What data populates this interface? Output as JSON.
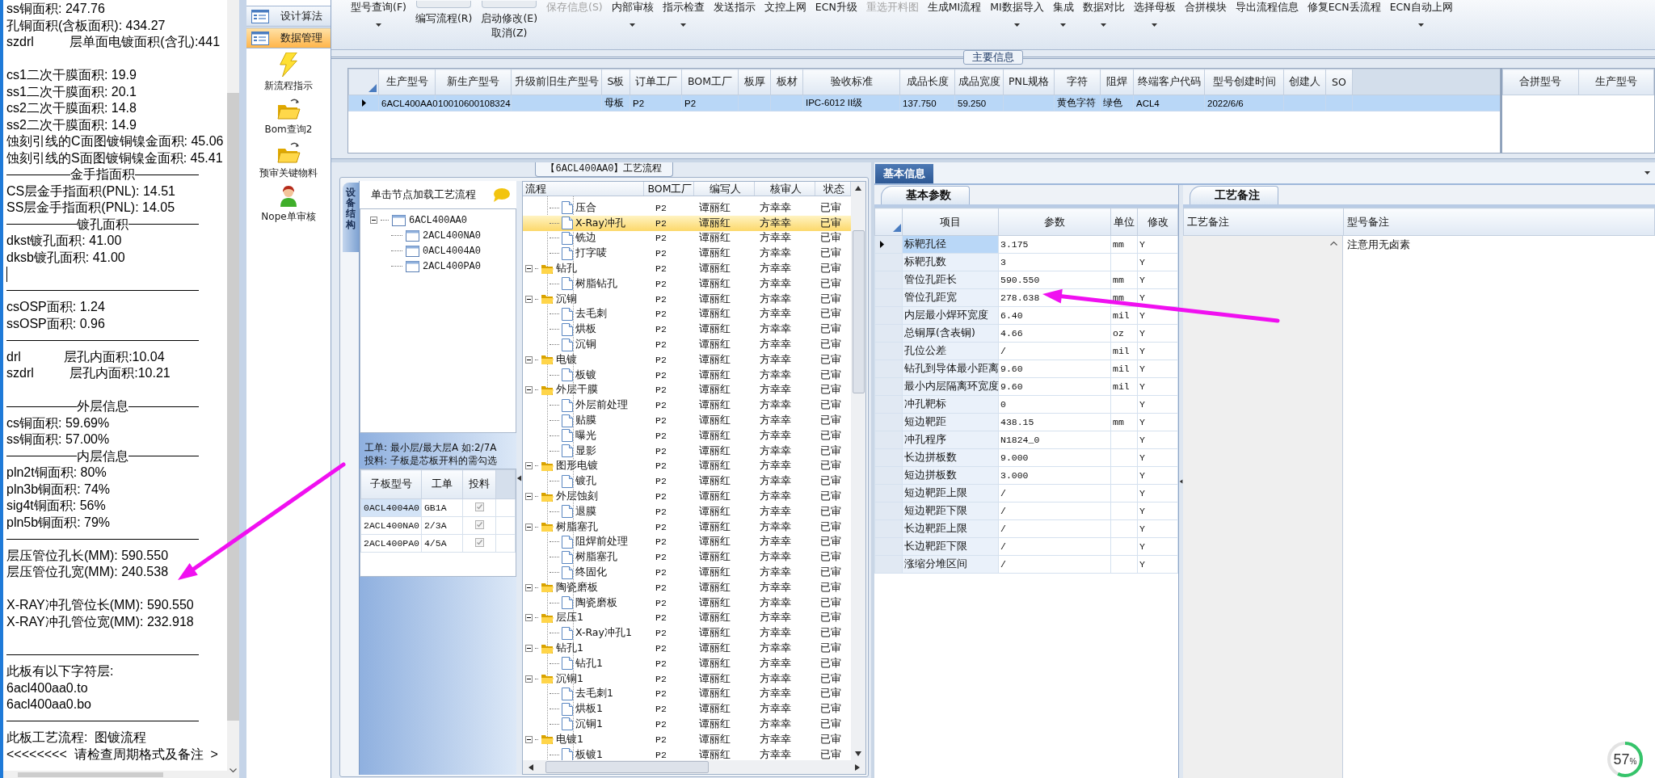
{
  "report_panel": {
    "lines": [
      {
        "kind": "text",
        "text": "ss铜面积: 247.76"
      },
      {
        "kind": "text",
        "text": "孔铜面积(含板面积): 434.27"
      },
      {
        "kind": "text",
        "text": "szdrl          层单面电镀面积(含孔):441"
      },
      {
        "kind": "blank"
      },
      {
        "kind": "text",
        "text": "cs1二次干膜面积: 19.9"
      },
      {
        "kind": "text",
        "text": "ss1二次干膜面积: 20.1"
      },
      {
        "kind": "text",
        "text": "cs2二次干膜面积: 14.8"
      },
      {
        "kind": "text",
        "text": "ss2二次干膜面积: 14.9"
      },
      {
        "kind": "text",
        "text": "蚀刻引线的C面图镀铜镍金面积: 45.06"
      },
      {
        "kind": "text",
        "text": "蚀刻引线的S面图镀铜镍金面积: 45.41"
      },
      {
        "kind": "heading",
        "text": "金手指面积"
      },
      {
        "kind": "text",
        "text": "CS层金手指面积(PNL): 14.51"
      },
      {
        "kind": "text",
        "text": "SS层金手指面积(PNL): 14.05"
      },
      {
        "kind": "heading",
        "text": "镀孔面积"
      },
      {
        "kind": "text",
        "text": "dkst镀孔面积: 41.00"
      },
      {
        "kind": "text",
        "text": "dksb镀孔面积: 41.00"
      },
      {
        "kind": "caret"
      },
      {
        "kind": "rule"
      },
      {
        "kind": "text",
        "text": "csOSP面积: 1.24"
      },
      {
        "kind": "text",
        "text": "ssOSP面积: 0.96"
      },
      {
        "kind": "rule"
      },
      {
        "kind": "text",
        "text": "drl            层孔内面积:10.04"
      },
      {
        "kind": "text",
        "text": "szdrl          层孔内面积:10.21"
      },
      {
        "kind": "blank"
      },
      {
        "kind": "heading",
        "text": "外层信息"
      },
      {
        "kind": "text",
        "text": "cs铜面积: 59.69%"
      },
      {
        "kind": "text",
        "text": "ss铜面积: 57.00%"
      },
      {
        "kind": "heading",
        "text": "内层信息"
      },
      {
        "kind": "text",
        "text": "pln2t铜面积: 80%"
      },
      {
        "kind": "text",
        "text": "pln3b铜面积: 74%"
      },
      {
        "kind": "text",
        "text": "sig4t铜面积: 56%"
      },
      {
        "kind": "text",
        "text": "pln5b铜面积: 79%"
      },
      {
        "kind": "rule"
      },
      {
        "kind": "text",
        "text": "层压管位孔长(MM): 590.550"
      },
      {
        "kind": "text",
        "text": "层压管位孔宽(MM): 240.538"
      },
      {
        "kind": "blank"
      },
      {
        "kind": "text",
        "text": "X-RAY冲孔管位长(MM): 590.550"
      },
      {
        "kind": "text",
        "text": "X-RAY冲孔管位宽(MM): 232.918"
      },
      {
        "kind": "blank"
      },
      {
        "kind": "rule"
      },
      {
        "kind": "text",
        "text": "此板有以下字符层:"
      },
      {
        "kind": "text",
        "text": "6acl400aa0.to"
      },
      {
        "kind": "text",
        "text": "6acl400aa0.bo"
      },
      {
        "kind": "rule"
      },
      {
        "kind": "text",
        "text": "此板工艺流程:  图镀流程"
      },
      {
        "kind": "text",
        "text": "<<<<<<<<  请检查周期格式及备注  >"
      }
    ]
  },
  "nav": {
    "items": [
      {
        "label": "设计算法",
        "selected": false
      },
      {
        "label": "数据管理",
        "selected": true
      }
    ],
    "launchers": [
      {
        "label": "新流程指示",
        "kind": "bolt"
      },
      {
        "label": "Bom查询2",
        "kind": "folder"
      },
      {
        "label": "预审关键物料",
        "kind": "folder"
      },
      {
        "label": "Nope单审核",
        "kind": "user"
      }
    ]
  },
  "toolbar": [
    {
      "label": "型号查询(F)",
      "kind": "text",
      "dropdown": true,
      "disabled": false
    },
    {
      "label": "编写流程(R)",
      "kind": "image",
      "dropdown": false,
      "disabled": false
    },
    {
      "label": "启动修改(E)",
      "kind": "image",
      "dropdown": false,
      "disabled": false,
      "sub_label": "取消(Z)"
    },
    {
      "label": "保存信息(S)",
      "kind": "text",
      "dropdown": false,
      "disabled": true
    },
    {
      "label": "内部审核",
      "kind": "text",
      "dropdown": true,
      "disabled": false
    },
    {
      "label": "指示检查",
      "kind": "text",
      "dropdown": true,
      "disabled": false
    },
    {
      "label": "发送指示",
      "kind": "text",
      "dropdown": false,
      "disabled": false
    },
    {
      "label": "文控上网",
      "kind": "text",
      "dropdown": false,
      "disabled": false
    },
    {
      "label": "ECN升级",
      "kind": "text",
      "dropdown": false,
      "disabled": false
    },
    {
      "label": "重选开料图",
      "kind": "text",
      "dropdown": false,
      "disabled": true
    },
    {
      "label": "生成MI流程",
      "kind": "text",
      "dropdown": false,
      "disabled": false
    },
    {
      "label": "MI数据导入",
      "kind": "text",
      "dropdown": true,
      "disabled": false
    },
    {
      "label": "集成",
      "kind": "text",
      "dropdown": true,
      "disabled": false
    },
    {
      "label": "数据对比",
      "kind": "text",
      "dropdown": true,
      "disabled": false
    },
    {
      "label": "选择母板",
      "kind": "text",
      "dropdown": true,
      "disabled": false
    },
    {
      "label": "合拼模块",
      "kind": "text",
      "dropdown": false,
      "disabled": false
    },
    {
      "label": "导出流程信息",
      "kind": "text",
      "dropdown": false,
      "disabled": false
    },
    {
      "label": "修复ECN丢流程",
      "kind": "text",
      "dropdown": false,
      "disabled": false
    },
    {
      "label": "ECN自动上网",
      "kind": "text",
      "dropdown": true,
      "disabled": false
    }
  ],
  "main_info": {
    "title": "主要信息",
    "columns": [
      "生产型号",
      "新生产型号",
      "升级前旧生产型号",
      "S板",
      "订单工厂",
      "BOM工厂",
      "板厚",
      "板材",
      "验收标准",
      "成品长度",
      "成品宽度",
      "PNL规格",
      "字符",
      "阻焊",
      "终端客户代码",
      "型号创建时间",
      "创建人",
      "SO"
    ],
    "rows": [
      {
        "selected": true,
        "cells": [
          "6ACL400AA0",
          "10010600108324",
          null,
          "母板",
          "P2",
          "P2",
          null,
          null,
          "IPC-6012 II级",
          "137.750",
          "59.250",
          null,
          "黄色字符",
          "绿色",
          "ACL4",
          "2022/6/6",
          null,
          null
        ]
      }
    ],
    "merge_table": {
      "columns": [
        "合拼型号",
        "生产型号"
      ]
    }
  },
  "process": {
    "title": "【6ACL400AA0】工艺流程",
    "side_tabs": [
      {
        "label": "设备结构",
        "selected": true
      }
    ],
    "tree_hint": "单击节点加载工艺流程",
    "tree": [
      {
        "label": "6ACL400AA0",
        "expanded": true,
        "children": [
          {
            "label": "2ACL400NA0"
          },
          {
            "label": "0ACL4004A0"
          },
          {
            "label": "2ACL400PA0"
          }
        ]
      }
    ],
    "notes": [
      "工单: 最小层/最大层A 如:2/7A",
      "投料: 子板是芯板开料的需勾选"
    ],
    "sub_boards": {
      "columns": [
        "子板型号",
        "工单",
        "投料"
      ],
      "rows": [
        {
          "board": "0ACL4004A0",
          "order": "GB1A",
          "feed": true,
          "selected": true
        },
        {
          "board": "2ACL400NA0",
          "order": "2/3A",
          "feed": true,
          "selected": false
        },
        {
          "board": "2ACL400PA0",
          "order": "4/5A",
          "feed": true,
          "selected": false
        }
      ]
    },
    "flow": {
      "columns": [
        "流程",
        "BOM工厂",
        "编写人",
        "核审人",
        "状态"
      ],
      "steps": [
        {
          "children": [
            {
              "kind": "step",
              "label": "压合",
              "bom": "P2",
              "writer": "谭丽红",
              "reviewer": "方幸幸",
              "status": "已审",
              "selected": false
            },
            {
              "kind": "step",
              "label": "X-Ray冲孔",
              "bom": "P2",
              "writer": "谭丽红",
              "reviewer": "方幸幸",
              "status": "已审",
              "selected": true
            },
            {
              "kind": "step",
              "label": "铣边",
              "bom": "P2",
              "writer": "谭丽红",
              "reviewer": "方幸幸",
              "status": "已审",
              "selected": false
            },
            {
              "kind": "step",
              "label": "打字唛",
              "bom": "P2",
              "writer": "谭丽红",
              "reviewer": "方幸幸",
              "status": "已审",
              "selected": false
            }
          ]
        },
        {
          "kind": "folder",
          "label": "钻孔",
          "bom": "P2",
          "writer": "谭丽红",
          "reviewer": "方幸幸",
          "status": "已审",
          "selected": false,
          "expanded": true,
          "children": [
            {
              "kind": "step",
              "label": "树脂钻孔",
              "bom": "P2",
              "writer": "谭丽红",
              "reviewer": "方幸幸",
              "status": "已审",
              "selected": false
            }
          ]
        },
        {
          "kind": "folder",
          "label": "沉铜",
          "bom": "P2",
          "writer": "谭丽红",
          "reviewer": "方幸幸",
          "status": "已审",
          "selected": false,
          "expanded": true,
          "children": [
            {
              "kind": "step",
              "label": "去毛刺",
              "bom": "P2",
              "writer": "谭丽红",
              "reviewer": "方幸幸",
              "status": "已审",
              "selected": false
            },
            {
              "kind": "step",
              "label": "烘板",
              "bom": "P2",
              "writer": "谭丽红",
              "reviewer": "方幸幸",
              "status": "已审",
              "selected": false
            },
            {
              "kind": "step",
              "label": "沉铜",
              "bom": "P2",
              "writer": "谭丽红",
              "reviewer": "方幸幸",
              "status": "已审",
              "selected": false
            }
          ]
        },
        {
          "kind": "folder",
          "label": "电镀",
          "bom": "P2",
          "writer": "谭丽红",
          "reviewer": "方幸幸",
          "status": "已审",
          "selected": false,
          "expanded": true,
          "children": [
            {
              "kind": "step",
              "label": "板镀",
              "bom": "P2",
              "writer": "谭丽红",
              "reviewer": "方幸幸",
              "status": "已审",
              "selected": false
            }
          ]
        },
        {
          "kind": "folder",
          "label": "外层干膜",
          "bom": "P2",
          "writer": "谭丽红",
          "reviewer": "方幸幸",
          "status": "已审",
          "selected": false,
          "expanded": true,
          "children": [
            {
              "kind": "step",
              "label": "外层前处理",
              "bom": "P2",
              "writer": "谭丽红",
              "reviewer": "方幸幸",
              "status": "已审",
              "selected": false
            },
            {
              "kind": "step",
              "label": "贴膜",
              "bom": "P2",
              "writer": "谭丽红",
              "reviewer": "方幸幸",
              "status": "已审",
              "selected": false
            },
            {
              "kind": "step",
              "label": "曝光",
              "bom": "P2",
              "writer": "谭丽红",
              "reviewer": "方幸幸",
              "status": "已审",
              "selected": false
            },
            {
              "kind": "step",
              "label": "显影",
              "bom": "P2",
              "writer": "谭丽红",
              "reviewer": "方幸幸",
              "status": "已审",
              "selected": false
            }
          ]
        },
        {
          "kind": "folder",
          "label": "图形电镀",
          "bom": "P2",
          "writer": "谭丽红",
          "reviewer": "方幸幸",
          "status": "已审",
          "selected": false,
          "expanded": true,
          "children": [
            {
              "kind": "step",
              "label": "镀孔",
              "bom": "P2",
              "writer": "谭丽红",
              "reviewer": "方幸幸",
              "status": "已审",
              "selected": false
            }
          ]
        },
        {
          "kind": "folder",
          "label": "外层蚀刻",
          "bom": "P2",
          "writer": "谭丽红",
          "reviewer": "方幸幸",
          "status": "已审",
          "selected": false,
          "expanded": true,
          "children": [
            {
              "kind": "step",
              "label": "退膜",
              "bom": "P2",
              "writer": "谭丽红",
              "reviewer": "方幸幸",
              "status": "已审",
              "selected": false
            }
          ]
        },
        {
          "kind": "folder",
          "label": "树脂塞孔",
          "bom": "P2",
          "writer": "谭丽红",
          "reviewer": "方幸幸",
          "status": "已审",
          "selected": false,
          "expanded": true,
          "children": [
            {
              "kind": "step",
              "label": "阻焊前处理",
              "bom": "P2",
              "writer": "谭丽红",
              "reviewer": "方幸幸",
              "status": "已审",
              "selected": false
            },
            {
              "kind": "step",
              "label": "树脂塞孔",
              "bom": "P2",
              "writer": "谭丽红",
              "reviewer": "方幸幸",
              "status": "已审",
              "selected": false
            },
            {
              "kind": "step",
              "label": "终固化",
              "bom": "P2",
              "writer": "谭丽红",
              "reviewer": "方幸幸",
              "status": "已审",
              "selected": false
            }
          ]
        },
        {
          "kind": "folder",
          "label": "陶瓷磨板",
          "bom": "P2",
          "writer": "谭丽红",
          "reviewer": "方幸幸",
          "status": "已审",
          "selected": false,
          "expanded": true,
          "children": [
            {
              "kind": "step",
              "label": "陶瓷磨板",
              "bom": "P2",
              "writer": "谭丽红",
              "reviewer": "方幸幸",
              "status": "已审",
              "selected": false
            }
          ]
        },
        {
          "kind": "folder",
          "label": "层压1",
          "bom": "P2",
          "writer": "谭丽红",
          "reviewer": "方幸幸",
          "status": "已审",
          "selected": false,
          "expanded": true,
          "children": [
            {
              "kind": "step",
              "label": "X-Ray冲孔1",
              "bom": "P2",
              "writer": "谭丽红",
              "reviewer": "方幸幸",
              "status": "已审",
              "selected": false
            }
          ]
        },
        {
          "kind": "folder",
          "label": "钻孔1",
          "bom": "P2",
          "writer": "谭丽红",
          "reviewer": "方幸幸",
          "status": "已审",
          "selected": false,
          "expanded": true,
          "children": [
            {
              "kind": "step",
              "label": "钻孔1",
              "bom": "P2",
              "writer": "谭丽红",
              "reviewer": "方幸幸",
              "status": "已审",
              "selected": false
            }
          ]
        },
        {
          "kind": "folder",
          "label": "沉铜1",
          "bom": "P2",
          "writer": "谭丽红",
          "reviewer": "方幸幸",
          "status": "已审",
          "selected": false,
          "expanded": true,
          "children": [
            {
              "kind": "step",
              "label": "去毛刺1",
              "bom": "P2",
              "writer": "谭丽红",
              "reviewer": "方幸幸",
              "status": "已审",
              "selected": false
            },
            {
              "kind": "step",
              "label": "烘板1",
              "bom": "P2",
              "writer": "谭丽红",
              "reviewer": "方幸幸",
              "status": "已审",
              "selected": false
            },
            {
              "kind": "step",
              "label": "沉铜1",
              "bom": "P2",
              "writer": "谭丽红",
              "reviewer": "方幸幸",
              "status": "已审",
              "selected": false
            }
          ]
        },
        {
          "kind": "folder",
          "label": "电镀1",
          "bom": "P2",
          "writer": "谭丽红",
          "reviewer": "方幸幸",
          "status": "已审",
          "selected": false,
          "expanded": true,
          "children": [
            {
              "kind": "step",
              "label": "板镀1",
              "bom": "P2",
              "writer": "谭丽红",
              "reviewer": "方幸幸",
              "status": "已审",
              "selected": false
            }
          ]
        }
      ]
    }
  },
  "basic_info": {
    "tabs": [
      {
        "label": "基本信息",
        "selected": true
      }
    ],
    "params": {
      "tabs": [
        {
          "label": "基本参数",
          "selected": true
        }
      ],
      "columns": [
        "项目",
        "参数",
        "单位",
        "修改"
      ],
      "rows": [
        {
          "item": "标靶孔径",
          "value": "3.175",
          "unit": "mm",
          "modify": "Y",
          "selected": true
        },
        {
          "item": "标靶孔数",
          "value": "3",
          "unit": null,
          "modify": "Y",
          "selected": false
        },
        {
          "item": "管位孔距长",
          "value": "590.550",
          "unit": "mm",
          "modify": "Y",
          "selected": false
        },
        {
          "item": "管位孔距宽",
          "value": "278.638",
          "unit": "mm",
          "modify": "Y",
          "selected": false
        },
        {
          "item": "内层最小焊环宽度",
          "value": "6.40",
          "unit": "mil",
          "modify": "Y",
          "selected": false
        },
        {
          "item": "总铜厚(含表铜)",
          "value": "4.66",
          "unit": "oz",
          "modify": "Y",
          "selected": false
        },
        {
          "item": "孔位公差",
          "value": "/",
          "unit": "mil",
          "modify": "Y",
          "selected": false
        },
        {
          "item": "钻孔到导体最小距离",
          "value": "9.60",
          "unit": "mil",
          "modify": "Y",
          "selected": false
        },
        {
          "item": "最小内层隔离环宽度",
          "value": "9.60",
          "unit": "mil",
          "modify": "Y",
          "selected": false
        },
        {
          "item": "冲孔靶标",
          "value": "0",
          "unit": null,
          "modify": "Y",
          "selected": false
        },
        {
          "item": "短边靶距",
          "value": "438.15",
          "unit": "mm",
          "modify": "Y",
          "selected": false
        },
        {
          "item": "冲孔程序",
          "value": "N1824_0",
          "unit": null,
          "modify": "Y",
          "selected": false
        },
        {
          "item": "长边拼板数",
          "value": "9.000",
          "unit": null,
          "modify": "Y",
          "selected": false
        },
        {
          "item": "短边拼板数",
          "value": "3.000",
          "unit": null,
          "modify": "Y",
          "selected": false
        },
        {
          "item": "短边靶距上限",
          "value": "/",
          "unit": null,
          "modify": "Y",
          "selected": false
        },
        {
          "item": "短边靶距下限",
          "value": "/",
          "unit": null,
          "modify": "Y",
          "selected": false
        },
        {
          "item": "长边靶距上限",
          "value": "/",
          "unit": null,
          "modify": "Y",
          "selected": false
        },
        {
          "item": "长边靶距下限",
          "value": "/",
          "unit": null,
          "modify": "Y",
          "selected": false
        },
        {
          "item": "涨缩分堆区间",
          "value": "/",
          "unit": null,
          "modify": "Y",
          "selected": false
        }
      ]
    },
    "remarks": {
      "tabs": [
        {
          "label": "工艺备注",
          "selected": true
        }
      ],
      "columns": [
        "工艺备注",
        "型号备注"
      ],
      "rows": [
        {
          "model_note": "注意用无卤素"
        }
      ]
    }
  },
  "annotations": [
    {
      "kind": "arrow"
    },
    {
      "kind": "arrow"
    }
  ],
  "progress_badge": {
    "text": "57",
    "unit": "%",
    "level": 0.57
  }
}
